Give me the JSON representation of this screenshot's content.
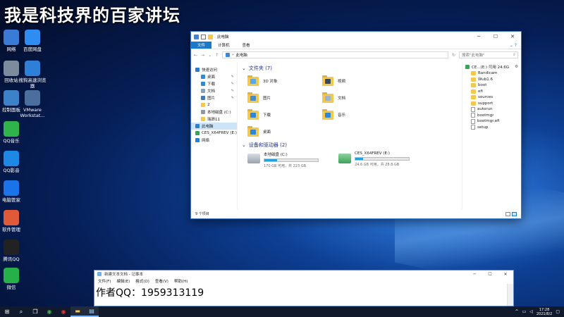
{
  "overlay_title": "我是科技界的百家讲坛",
  "desktop_icons": [
    {
      "label": "网络",
      "icon": "network-icon",
      "color": "#3a7bd5"
    },
    {
      "label": "百度网盘",
      "icon": "cloud-icon",
      "color": "#2f8cf0"
    },
    {
      "label": "回收站",
      "icon": "recycle-bin-icon",
      "color": "#7d8c9c"
    },
    {
      "label": "搜狗高速浏览器",
      "icon": "sogou-browser-icon",
      "color": "#2d7fd8"
    },
    {
      "label": "控制面板",
      "icon": "control-panel-icon",
      "color": "#3c82c9"
    },
    {
      "label": "VMware Workstat...",
      "icon": "vmware-icon",
      "color": "#4a6f9e"
    },
    {
      "label": "QQ音乐",
      "icon": "music-icon",
      "color": "#2fb44b"
    },
    {
      "label": "QQ影音",
      "icon": "video-icon",
      "color": "#1e88e5"
    },
    {
      "label": "电脑管家",
      "icon": "shield-icon",
      "color": "#1a73e8"
    },
    {
      "label": "软件管理",
      "icon": "apps-icon",
      "color": "#e05a3a"
    },
    {
      "label": "腾讯QQ",
      "icon": "qq-icon",
      "color": "#222222"
    },
    {
      "label": "微信",
      "icon": "wechat-icon",
      "color": "#26b04a"
    }
  ],
  "explorer": {
    "title": "此电脑",
    "ribbon_tabs": [
      "文件",
      "计算机",
      "查看"
    ],
    "address": "此电脑",
    "search_placeholder": "搜索\"此电脑\"",
    "nav_items": [
      {
        "label": "快速访问",
        "icon": "star-icon",
        "color": "#2a7bd4",
        "pinned": false,
        "level": 0
      },
      {
        "label": "桌面",
        "icon": "desktop-icon",
        "color": "#2e8bd8",
        "pinned": true,
        "level": 1
      },
      {
        "label": "下载",
        "icon": "download-icon",
        "color": "#2e8bd8",
        "pinned": true,
        "level": 1
      },
      {
        "label": "文档",
        "icon": "document-icon",
        "color": "#8aa2b8",
        "pinned": true,
        "level": 1
      },
      {
        "label": "图片",
        "icon": "pictures-icon",
        "color": "#3a7bb8",
        "pinned": true,
        "level": 1
      },
      {
        "label": "2",
        "icon": "folder-icon",
        "color": "#f5c84b",
        "pinned": false,
        "level": 1
      },
      {
        "label": "本地磁盘 (C:)",
        "icon": "drive-icon",
        "color": "#8e98a4",
        "pinned": false,
        "level": 1
      },
      {
        "label": "瑞昂11",
        "icon": "folder-icon",
        "color": "#f5c84b",
        "pinned": false,
        "level": 1
      },
      {
        "label": "此电脑",
        "icon": "computer-icon",
        "color": "#2f7fd1",
        "pinned": false,
        "level": 0,
        "selected": true
      },
      {
        "label": "CES_X64FREV (E:)",
        "icon": "dvd-drive-icon",
        "color": "#3aa35a",
        "pinned": false,
        "level": 0
      },
      {
        "label": "网络",
        "icon": "network-icon",
        "color": "#2f7fd1",
        "pinned": false,
        "level": 0
      }
    ],
    "folders_header": "文件夹 (7)",
    "folders": [
      {
        "label": "3D 对象",
        "glyph_color": "#5aa9e6"
      },
      {
        "label": "视频",
        "glyph_color": "#394a5a"
      },
      {
        "label": "图片",
        "glyph_color": "#4a8bcf"
      },
      {
        "label": "文档",
        "glyph_color": "#9fb4c8"
      },
      {
        "label": "下载",
        "glyph_color": "#2e86d6"
      },
      {
        "label": "音乐",
        "glyph_color": "#2e86d6"
      },
      {
        "label": "桌面",
        "glyph_color": "#2e86d6"
      }
    ],
    "drives_header": "设备和驱动器 (2)",
    "drives": [
      {
        "name": "本地磁盘 (C:)",
        "free": "170 GB 可用，共 223 GB",
        "used_fraction": 0.24
      },
      {
        "name": "CES_X64FREV (E:)",
        "free": "24.6 GB 可用，共 28.8 GB",
        "used_fraction": 0.15
      }
    ],
    "preview": {
      "header": "CE...(E:) 可用 24.6G",
      "items": [
        {
          "label": "Bandicam",
          "type": "folder"
        },
        {
          "label": "Wub1.6",
          "type": "folder"
        },
        {
          "label": "boot",
          "type": "folder"
        },
        {
          "label": "efi",
          "type": "folder"
        },
        {
          "label": "sources",
          "type": "folder"
        },
        {
          "label": "support",
          "type": "folder"
        },
        {
          "label": "autorun",
          "type": "file"
        },
        {
          "label": "bootmgr",
          "type": "file"
        },
        {
          "label": "bootmgr.efi",
          "type": "file"
        },
        {
          "label": "setup",
          "type": "file"
        }
      ]
    },
    "status": "9 个项目"
  },
  "notepad": {
    "title": "新建文本文档 - 记事本",
    "menu": [
      "文件(F)",
      "编辑(E)",
      "格式(O)",
      "查看(V)",
      "帮助(H)"
    ],
    "text": "作者QQ：1959313119"
  },
  "taskbar": {
    "clock_time": "17:28",
    "clock_date": "2021/8/2"
  }
}
